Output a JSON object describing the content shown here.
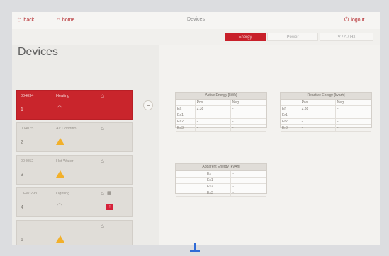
{
  "topbar": {
    "back_label": "back",
    "home_label": "home",
    "title": "Devices",
    "logout_label": "logout"
  },
  "tabs": [
    {
      "label": "Energy",
      "active": true
    },
    {
      "label": "Power",
      "active": false
    },
    {
      "label": "V / A / Hz",
      "active": false
    }
  ],
  "sidebar": {
    "title": "Devices",
    "items": [
      {
        "code": "004034",
        "name": "Heating",
        "num": "1",
        "status": "wifi",
        "active": true
      },
      {
        "code": "004075",
        "name": "Air Conditio",
        "num": "2",
        "status": "warning",
        "active": false
      },
      {
        "code": "004052",
        "name": "Hot Water",
        "num": "3",
        "status": "warning",
        "active": false
      },
      {
        "code": "DFW 293",
        "name": "Lighting",
        "num": "4",
        "status": "wifi",
        "active": false,
        "extra_icon": "building-icon",
        "badge": "!"
      },
      {
        "code": "",
        "name": "",
        "num": "5",
        "status": "warning",
        "active": false
      }
    ]
  },
  "tables": {
    "active": {
      "title": "Active Energy [kWh]",
      "cols": [
        "",
        "Pos",
        "Neg"
      ],
      "rows": [
        [
          "Ea",
          "2.38",
          "-"
        ],
        [
          "Ea1",
          "-",
          "-"
        ],
        [
          "Ea2",
          "-",
          "-"
        ],
        [
          "Ea3",
          "-",
          "-"
        ]
      ]
    },
    "reactive": {
      "title": "Reactive Energy [kvarh]",
      "cols": [
        "",
        "Pos",
        "Neg"
      ],
      "rows": [
        [
          "Er",
          "2.38",
          "-"
        ],
        [
          "Er1",
          "-",
          "-"
        ],
        [
          "Er2",
          "-",
          "-"
        ],
        [
          "Er3",
          "-",
          "-"
        ]
      ]
    },
    "apparent": {
      "title": "Apparent Energy [kVAh]",
      "rows": [
        [
          "Es",
          "-"
        ],
        [
          "Es1",
          "-"
        ],
        [
          "Es2",
          "-"
        ],
        [
          "Es3",
          "-"
        ]
      ]
    }
  },
  "colors": {
    "accent": "#c8202a",
    "warning": "#f2b02a"
  }
}
